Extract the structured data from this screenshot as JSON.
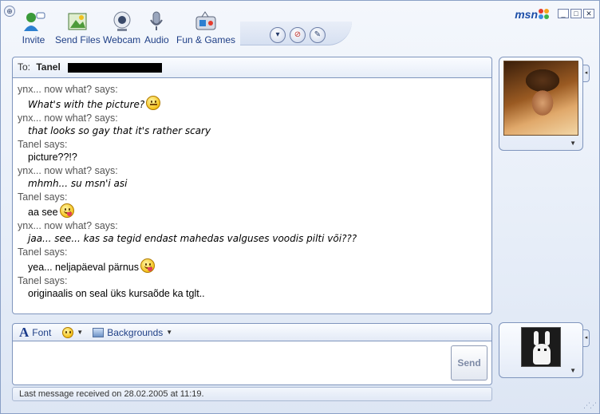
{
  "window": {
    "brand": "msn",
    "controls": [
      "_",
      "□",
      "✕"
    ]
  },
  "toolbar": {
    "items": [
      {
        "label": "Invite",
        "icon": "invite-icon"
      },
      {
        "label": "Send Files",
        "icon": "send-files-icon"
      },
      {
        "label": "Webcam",
        "icon": "webcam-icon"
      },
      {
        "label": "Audio",
        "icon": "audio-icon"
      },
      {
        "label": "Fun & Games",
        "icon": "fun-games-icon"
      }
    ],
    "round_buttons": [
      {
        "symbol": "▾",
        "icon": "more-icon"
      },
      {
        "symbol": "⊘",
        "icon": "block-icon"
      },
      {
        "symbol": "✎",
        "icon": "paint-icon"
      }
    ]
  },
  "to_bar": {
    "label": "To:",
    "name": "Tanel"
  },
  "conversation": {
    "messages": [
      {
        "sender": "ynx... now what? says:",
        "text": "What's with the picture?",
        "italic": true,
        "emoticon": "confused"
      },
      {
        "sender": "ynx... now what? says:",
        "text": "that looks so gay that it's rather scary",
        "italic": true,
        "emoticon": ""
      },
      {
        "sender": "Tanel says:",
        "text": "picture??!?",
        "italic": false,
        "emoticon": ""
      },
      {
        "sender": "ynx... now what? says:",
        "text": "mhmh... su msn'i asi",
        "italic": true,
        "emoticon": ""
      },
      {
        "sender": "Tanel says:",
        "text": "aa see",
        "italic": false,
        "emoticon": "tongue"
      },
      {
        "sender": "ynx... now what? says:",
        "text": "jaa... see... kas sa tegid endast mahedas valguses voodis pilti või???",
        "italic": true,
        "emoticon": ""
      },
      {
        "sender": "Tanel says:",
        "text": "yea... neljapäeval pärnus",
        "italic": false,
        "emoticon": "tongue"
      },
      {
        "sender": "Tanel says:",
        "text": "originaalis on seal üks kursaõde ka tglt..",
        "italic": false,
        "emoticon": ""
      }
    ]
  },
  "format_bar": {
    "font_glyph": "A",
    "font_label": "Font",
    "backgrounds_label": "Backgrounds"
  },
  "input": {
    "value": "",
    "send_label": "Send"
  },
  "status": {
    "text": "Last message received on 28.02.2005 at 11:19."
  },
  "colors": {
    "accent": "#1f3f86",
    "border": "#7f95bd",
    "window_bg": "#e6edf8"
  }
}
